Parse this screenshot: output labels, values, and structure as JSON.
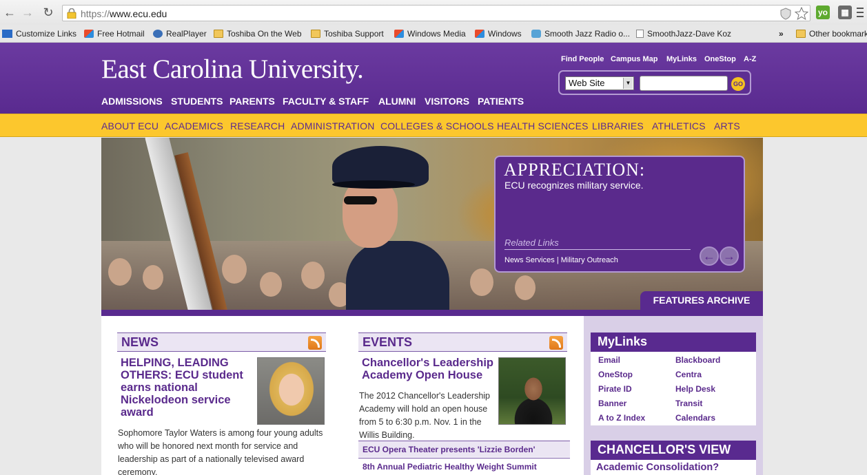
{
  "browser": {
    "url_scheme": "https://",
    "url_host": "www.ecu.edu",
    "bookmarks": [
      {
        "label": "Customize Links",
        "icon": "msn-icon"
      },
      {
        "label": "Free Hotmail",
        "icon": "ie-icon"
      },
      {
        "label": "RealPlayer",
        "icon": "realplayer-icon"
      },
      {
        "label": "Toshiba On the Web",
        "icon": "folder-icon"
      },
      {
        "label": "Toshiba Support",
        "icon": "folder-icon"
      },
      {
        "label": "Windows Media",
        "icon": "ie-icon"
      },
      {
        "label": "Windows",
        "icon": "ie-icon"
      },
      {
        "label": "Smooth Jazz Radio o...",
        "icon": "radio-icon"
      },
      {
        "label": "SmoothJazz-Dave Koz",
        "icon": "page-icon"
      },
      {
        "label": "Other bookmarks",
        "icon": "folder-icon"
      }
    ],
    "overflow": "»"
  },
  "header": {
    "logo": "East Carolina University.",
    "utility_links": [
      "Find People",
      "Campus Map",
      "MyLinks",
      "OneStop",
      "A-Z"
    ],
    "search_scope": "Web Site",
    "go_label": "GO",
    "main_nav": [
      "ADMISSIONS",
      "STUDENTS",
      "PARENTS",
      "FACULTY & STAFF",
      "ALUMNI",
      "VISITORS",
      "PATIENTS"
    ]
  },
  "secondary_nav": [
    "ABOUT ECU",
    "ACADEMICS",
    "RESEARCH",
    "ADMINISTRATION",
    "COLLEGES & SCHOOLS",
    "HEALTH SCIENCES",
    "LIBRARIES",
    "ATHLETICS",
    "ARTS"
  ],
  "feature": {
    "title": "APPRECIATION:",
    "subtitle": "ECU recognizes military service.",
    "related_label": "Related Links",
    "link1": "News Services",
    "separator": "|",
    "link2": "Military Outreach",
    "archive_label": "FEATURES ARCHIVE"
  },
  "news": {
    "heading": "NEWS",
    "headline": "HELPING, LEADING OTHERS: ECU student earns national Nickelodeon service award",
    "body": "Sophomore Taylor Waters is among four young adults who will be honored next month for service and leadership as part of a nationally televised award ceremony."
  },
  "events": {
    "heading": "EVENTS",
    "headline": "Chancellor's Leadership Academy Open House",
    "body": "The 2012 Chancellor's Leadership Academy will hold an open house from 5 to 6:30 p.m. Nov. 1 in the Willis Building.",
    "items": [
      "ECU Opera Theater presents 'Lizzie Borden'",
      "8th Annual Pediatric Healthy Weight Summit"
    ]
  },
  "mylinks": {
    "heading": "MyLinks",
    "col1": [
      "Email",
      "OneStop",
      "Pirate ID",
      "Banner",
      "A to Z Index"
    ],
    "col2": [
      "Blackboard",
      "Centra",
      "Help Desk",
      "Transit",
      "Calendars"
    ]
  },
  "chancellor": {
    "heading": "CHANCELLOR'S VIEW",
    "teaser": "Academic Consolidation?"
  },
  "colors": {
    "ecu_purple": "#592a8f",
    "ecu_gold": "#fcc72d"
  }
}
